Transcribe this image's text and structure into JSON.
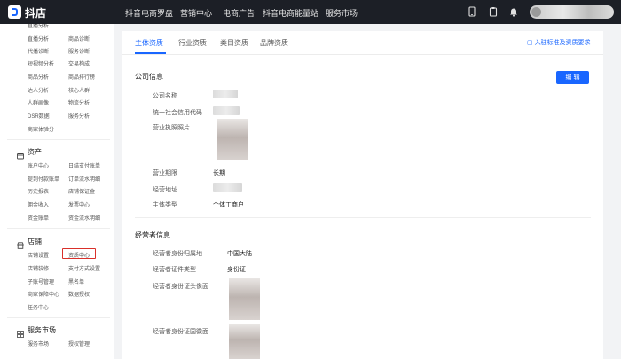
{
  "app": {
    "name": "抖店"
  },
  "topnav": [
    "抖音电商罗盘",
    "营销中心",
    "电商广告",
    "抖音电商能量站",
    "服务市场"
  ],
  "sidebar": {
    "top_links": [
      [
        "直播分析",
        "商品诊断"
      ],
      [
        "代播诊断",
        "服务诊断"
      ],
      [
        "短视频分析",
        "交易构成"
      ],
      [
        "商品分析",
        "商品排行榜"
      ],
      [
        "达人分析",
        "核心人群"
      ],
      [
        "人群画像",
        "物流分析"
      ],
      [
        "DSR数据",
        "服务分析"
      ],
      [
        "商家体验分"
      ]
    ],
    "sections": [
      {
        "title": "资产",
        "links": [
          [
            "账户中心",
            "日结支付账单"
          ],
          [
            "提到付款账单",
            "订单流水明细"
          ],
          [
            "历史报表",
            "店铺保证金"
          ],
          [
            "佣金收入",
            "发票中心"
          ],
          [
            "资金账单",
            "资金流水明细"
          ]
        ]
      },
      {
        "title": "店铺",
        "links": [
          [
            "店铺设置",
            "资质中心"
          ],
          [
            "店铺装修",
            "支付方式设置"
          ],
          [
            "子账号管理",
            "黑名单"
          ],
          [
            "商家保障中心",
            "数据授权"
          ],
          [
            "任务中心"
          ]
        ]
      },
      {
        "title": "服务市场",
        "links": [
          [
            "服务市场",
            "授权管理"
          ]
        ]
      }
    ]
  },
  "tabs": [
    "主体资质",
    "行业资质",
    "类目资质",
    "品牌资质"
  ],
  "req_link": "入驻标准及资质要求",
  "company": {
    "title": "公司信息",
    "edit_label": "编 辑",
    "labels": [
      "公司名称",
      "统一社会信用代码",
      "营业执照照片",
      "营业期限",
      "经营地址",
      "主体类型"
    ],
    "term": "长期",
    "subject_type": "个体工商户"
  },
  "operator": {
    "title": "经营者信息",
    "labels": [
      "经营者身份归属地",
      "经营者证件类型",
      "经营者身份证头像面",
      "经营者身份证国徽面"
    ],
    "region": "中国大陆",
    "id_type": "身份证"
  },
  "colors": {
    "accent": "#1966ff",
    "topbar": "#1c1f26",
    "highlight": "#d9302a"
  }
}
